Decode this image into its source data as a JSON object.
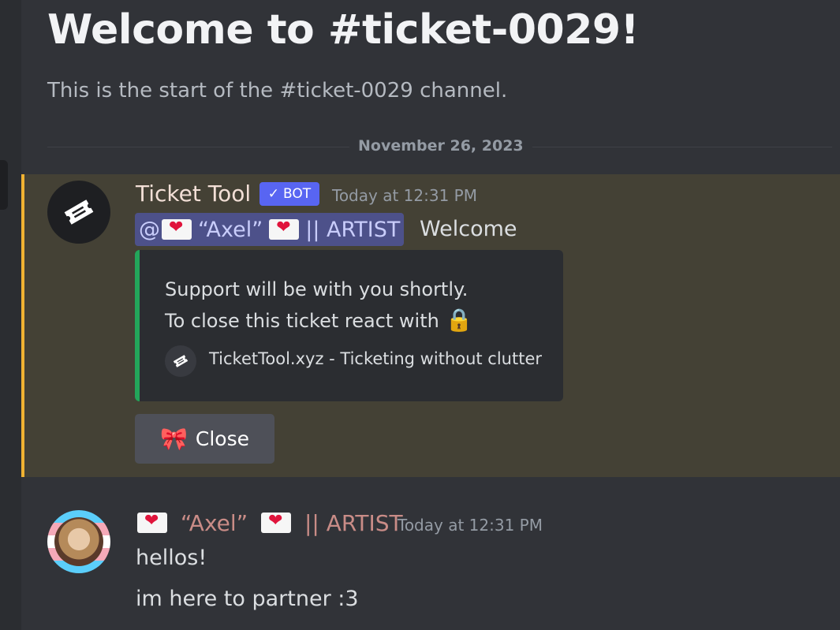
{
  "channel": {
    "welcome_title": "Welcome to #ticket-0029!",
    "welcome_subtitle": "This is the start of the #ticket-0029 channel."
  },
  "date_divider": "November 26, 2023",
  "bot_message": {
    "author": "Ticket Tool",
    "badge": "BOT",
    "badge_check": "✓",
    "timestamp": "Today at 12:31 PM",
    "mention_name": "“Axel”",
    "mention_suffix": "|| ARTIST",
    "mention_prefix": "@",
    "text": "Welcome",
    "embed": {
      "line1": "Support will be with you shortly.",
      "line2": "To close this ticket react with",
      "lock_icon": "🔒",
      "footer": "TicketTool.xyz - Ticketing without clutter",
      "accent_color": "#23a55a"
    },
    "button": {
      "emoji": "🎀",
      "label": "Close"
    },
    "highlight_color": "#f0b232"
  },
  "user_message": {
    "author_name": "“Axel”",
    "author_suffix": "|| ARTIST",
    "timestamp": "Today at 12:31 PM",
    "lines": [
      "hellos!",
      "im here to partner :3"
    ]
  }
}
